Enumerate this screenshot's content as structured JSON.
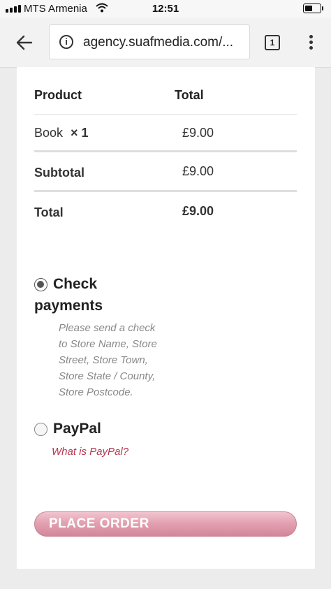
{
  "status_bar": {
    "carrier": "MTS Armenia",
    "time": "12:51"
  },
  "browser": {
    "url": "agency.suafmedia.com/...",
    "tab_count": "1"
  },
  "order_table": {
    "header_product": "Product",
    "header_total": "Total",
    "item_name": "Book",
    "item_qty": "× 1",
    "item_total": "£9.00",
    "subtotal_label": "Subtotal",
    "subtotal_value": "£9.00",
    "total_label": "Total",
    "total_value": "£9.00"
  },
  "payment": {
    "check_label_line1": "Check",
    "check_label_line2": "payments",
    "check_desc_lines": [
      "Please send a check",
      "to Store Name, Store",
      "Street, Store Town,",
      "Store State / County,",
      "Store Postcode."
    ],
    "paypal_label": "PayPal",
    "paypal_link": "What is PayPal?"
  },
  "place_order_label": "PLACE ORDER",
  "colors": {
    "link": "#b5344f",
    "button": "#e2a2b1"
  }
}
